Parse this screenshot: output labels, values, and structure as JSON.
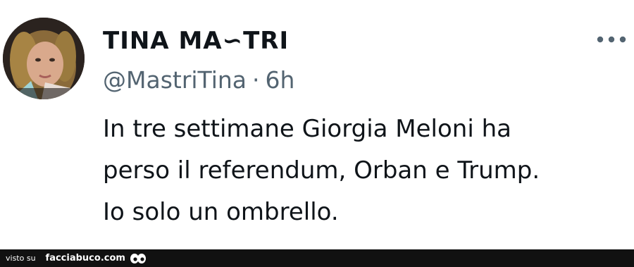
{
  "tweet": {
    "display_name": "TINA MA∽TRI",
    "handle": "@MastriTina",
    "separator": "·",
    "time": "6h",
    "more_icon": "more-horizontal-icon",
    "text_lines": [
      "In tre settimane Giorgia Meloni ha",
      "perso il referendum, Orban e Trump.",
      "Io solo un ombrello."
    ]
  },
  "footer": {
    "visto_su": "visto su",
    "site_name": "facciabuco.com",
    "logo_icon": "eyes-icon"
  },
  "colors": {
    "text_primary": "#0f1419",
    "text_secondary": "#536471",
    "footer_bg": "#111111"
  }
}
